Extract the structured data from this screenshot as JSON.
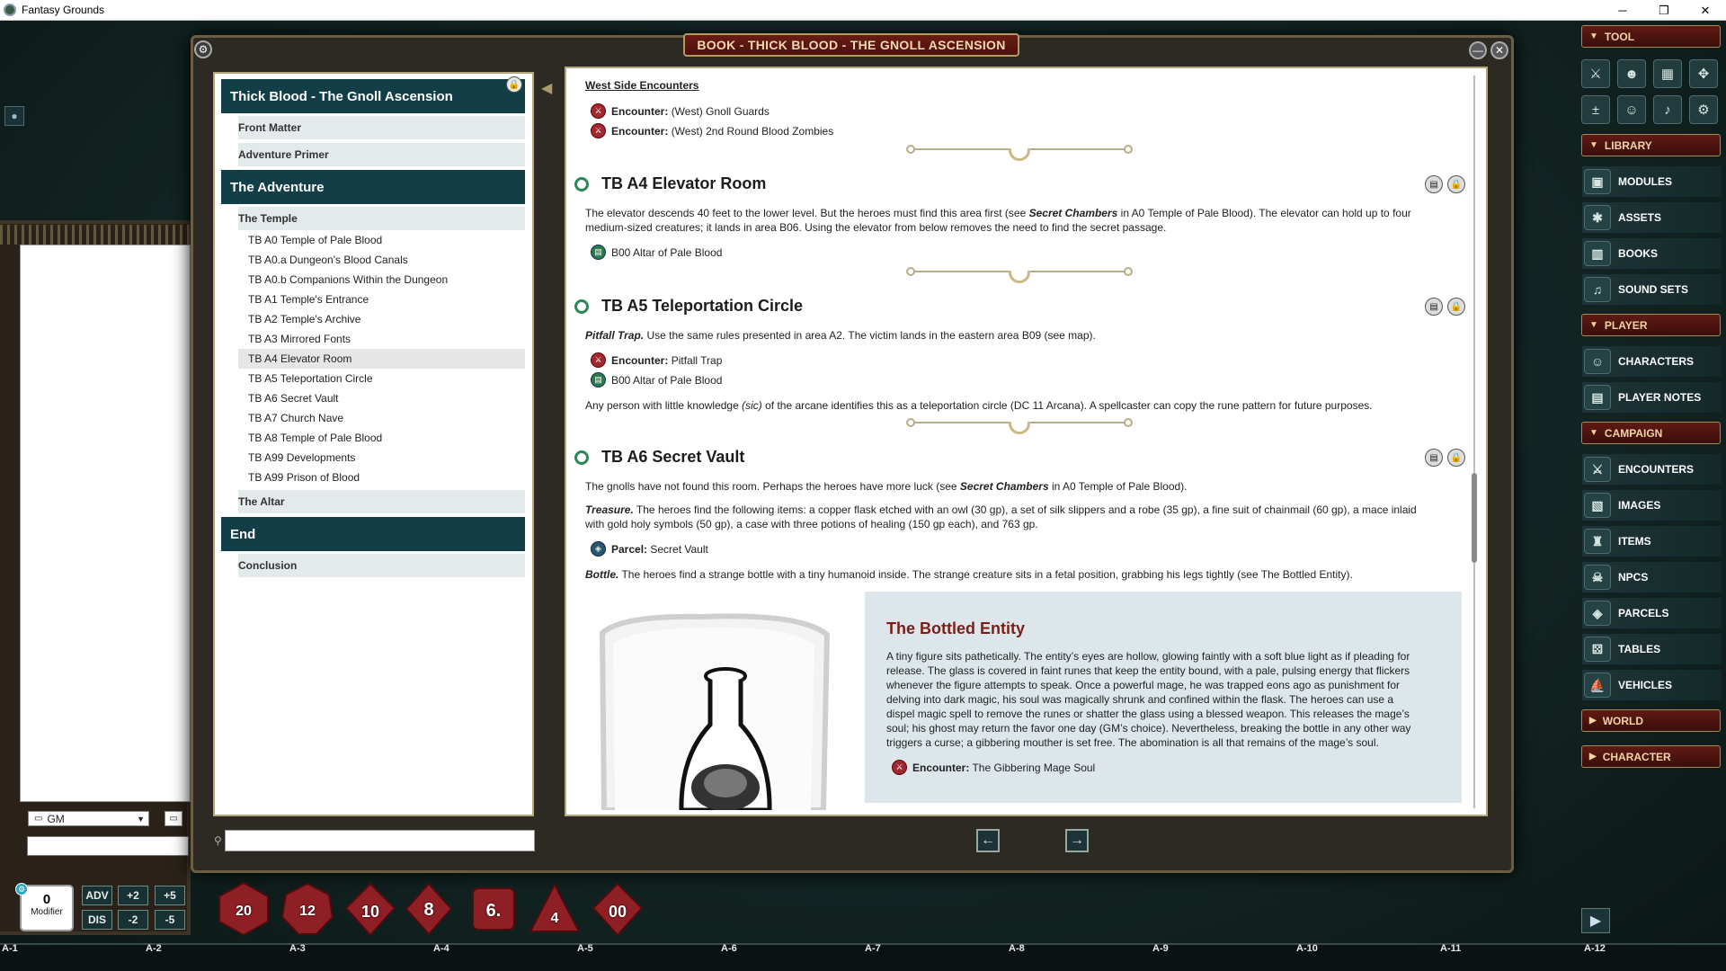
{
  "window": {
    "title": "Fantasy Grounds",
    "controls": [
      "─",
      "❐",
      "✕"
    ]
  },
  "book": {
    "title": "BOOK - THICK BLOOD - THE GNOLL ASCENSION"
  },
  "toc": {
    "header": "Thick Blood - The Gnoll Ascension",
    "front_matter": "Front Matter",
    "adventure_primer": "Adventure Primer",
    "chapter_adventure": "The Adventure",
    "the_temple": "The Temple",
    "temple_items": [
      "TB A0 Temple of Pale Blood",
      "TB A0.a Dungeon's Blood Canals",
      "TB A0.b Companions Within the Dungeon",
      "TB A1 Temple's Entrance",
      "TB A2 Temple's Archive",
      "TB A3 Mirrored Fonts",
      "TB A4 Elevator Room",
      "TB A5 Teleportation Circle",
      "TB A6 Secret Vault",
      "TB A7 Church Nave",
      "TB A8 Temple of Pale Blood",
      "TB A99 Developments",
      "TB A99 Prison of Blood"
    ],
    "the_altar": "The Altar",
    "chapter_end": "End",
    "conclusion": "Conclusion"
  },
  "content": {
    "west_heading": "West Side Encounters",
    "enc_label": "Encounter:",
    "parcel_label": "Parcel:",
    "west_links": [
      "(West) Gnoll Guards",
      "(West) 2nd Round Blood Zombies"
    ],
    "a4": {
      "title": "TB A4 Elevator Room",
      "p1a": "The elevator descends 40 feet to the lower level. But the heroes must find this area first (see ",
      "p1b": "Secret Chambers",
      "p1c": " in A0 Temple of Pale Blood). The elevator can hold up to four",
      "p1d": "medium-sized creatures; it lands in area B06. Using the elevator from below removes the need to find the secret passage.",
      "link": "B00 Altar of Pale Blood"
    },
    "a5": {
      "title": "TB A5 Teleportation Circle",
      "p1a": "Pitfall Trap.",
      "p1b": " Use the same rules presented in area A2. The victim lands in the eastern area B09 (see map).",
      "enc": "Pitfall Trap",
      "link": "B00 Altar of Pale Blood",
      "p2a": "Any person with little knowledge ",
      "p2b": "(sic)",
      "p2c": " of the arcane identifies this as a teleportation circle (DC 11 Arcana). A spellcaster can copy the rune pattern for future purposes."
    },
    "a6": {
      "title": "TB A6 Secret Vault",
      "p1a": "The gnolls have not found this room. Perhaps the heroes have more luck (see ",
      "p1b": "Secret Chambers",
      "p1c": " in A0 Temple of Pale Blood).",
      "t1": "Treasure.",
      "t2": " The heroes find the following items: a copper flask etched with an owl (30 gp), a set of silk slippers and a robe (35 gp), a fine suit of chainmail (60 gp), a mace inlaid",
      "t3": "with gold holy symbols (50 gp), a case with three potions of healing (150 gp each), and 763 gp.",
      "parcel": "Secret Vault",
      "b1": "Bottle.",
      "b2": " The heroes find a strange bottle with a tiny humanoid inside. The strange creature sits in a fetal position, grabbing his legs tightly (see The Bottled Entity)."
    },
    "box": {
      "title": "The Bottled Entity",
      "lines": [
        "A tiny figure sits pathetically. The entity’s eyes are hollow, glowing faintly with a soft blue light as if pleading for",
        "release. The glass is covered in faint runes that keep the entity bound, with a pale, pulsing energy that flickers",
        "whenever the figure attempts to speak. Once a powerful mage, he was trapped eons ago as punishment for",
        "delving into dark magic, his soul was magically shrunk and confined within the flask. The heroes can use a",
        "dispel magic spell to remove the runes or shatter the glass using a blessed weapon. This releases the mage’s",
        "soul; his ghost may return the favor one day (GM’s choice). Nevertheless, breaking the bottle in any other way",
        "triggers a curse; a gibbering mouther is set free. The abomination is all that remains of the mage’s soul."
      ],
      "enc": "The Gibbering Mage Soul"
    }
  },
  "chat": {
    "identity": "GM"
  },
  "sidebar": {
    "tool": "TOOL",
    "library": "LIBRARY",
    "library_items": [
      "MODULES",
      "ASSETS",
      "BOOKS",
      "SOUND SETS"
    ],
    "player": "PLAYER",
    "player_items": [
      "CHARACTERS",
      "PLAYER NOTES"
    ],
    "campaign": "CAMPAIGN",
    "campaign_items": [
      "ENCOUNTERS",
      "IMAGES",
      "ITEMS",
      "NPCS",
      "PARCELS",
      "TABLES",
      "VEHICLES"
    ],
    "world": "WORLD",
    "character": "CHARACTER"
  },
  "modifier": {
    "value": "0",
    "label": "Modifier",
    "adv": "ADV",
    "dis": "DIS",
    "p2": "+2",
    "p5": "+5",
    "m2": "-2",
    "m5": "-5"
  },
  "dice": [
    "20",
    "12",
    "10",
    "8",
    "6.",
    "4",
    "00"
  ],
  "hotkeys": [
    "A-1",
    "A-2",
    "A-3",
    "A-4",
    "A-5",
    "A-6",
    "A-7",
    "A-8",
    "A-9",
    "A-10",
    "A-11",
    "A-12"
  ],
  "colors": {
    "accent_red": "#7a1e19",
    "toc_blue": "#123f47",
    "sidebar_head": "#601a14"
  }
}
